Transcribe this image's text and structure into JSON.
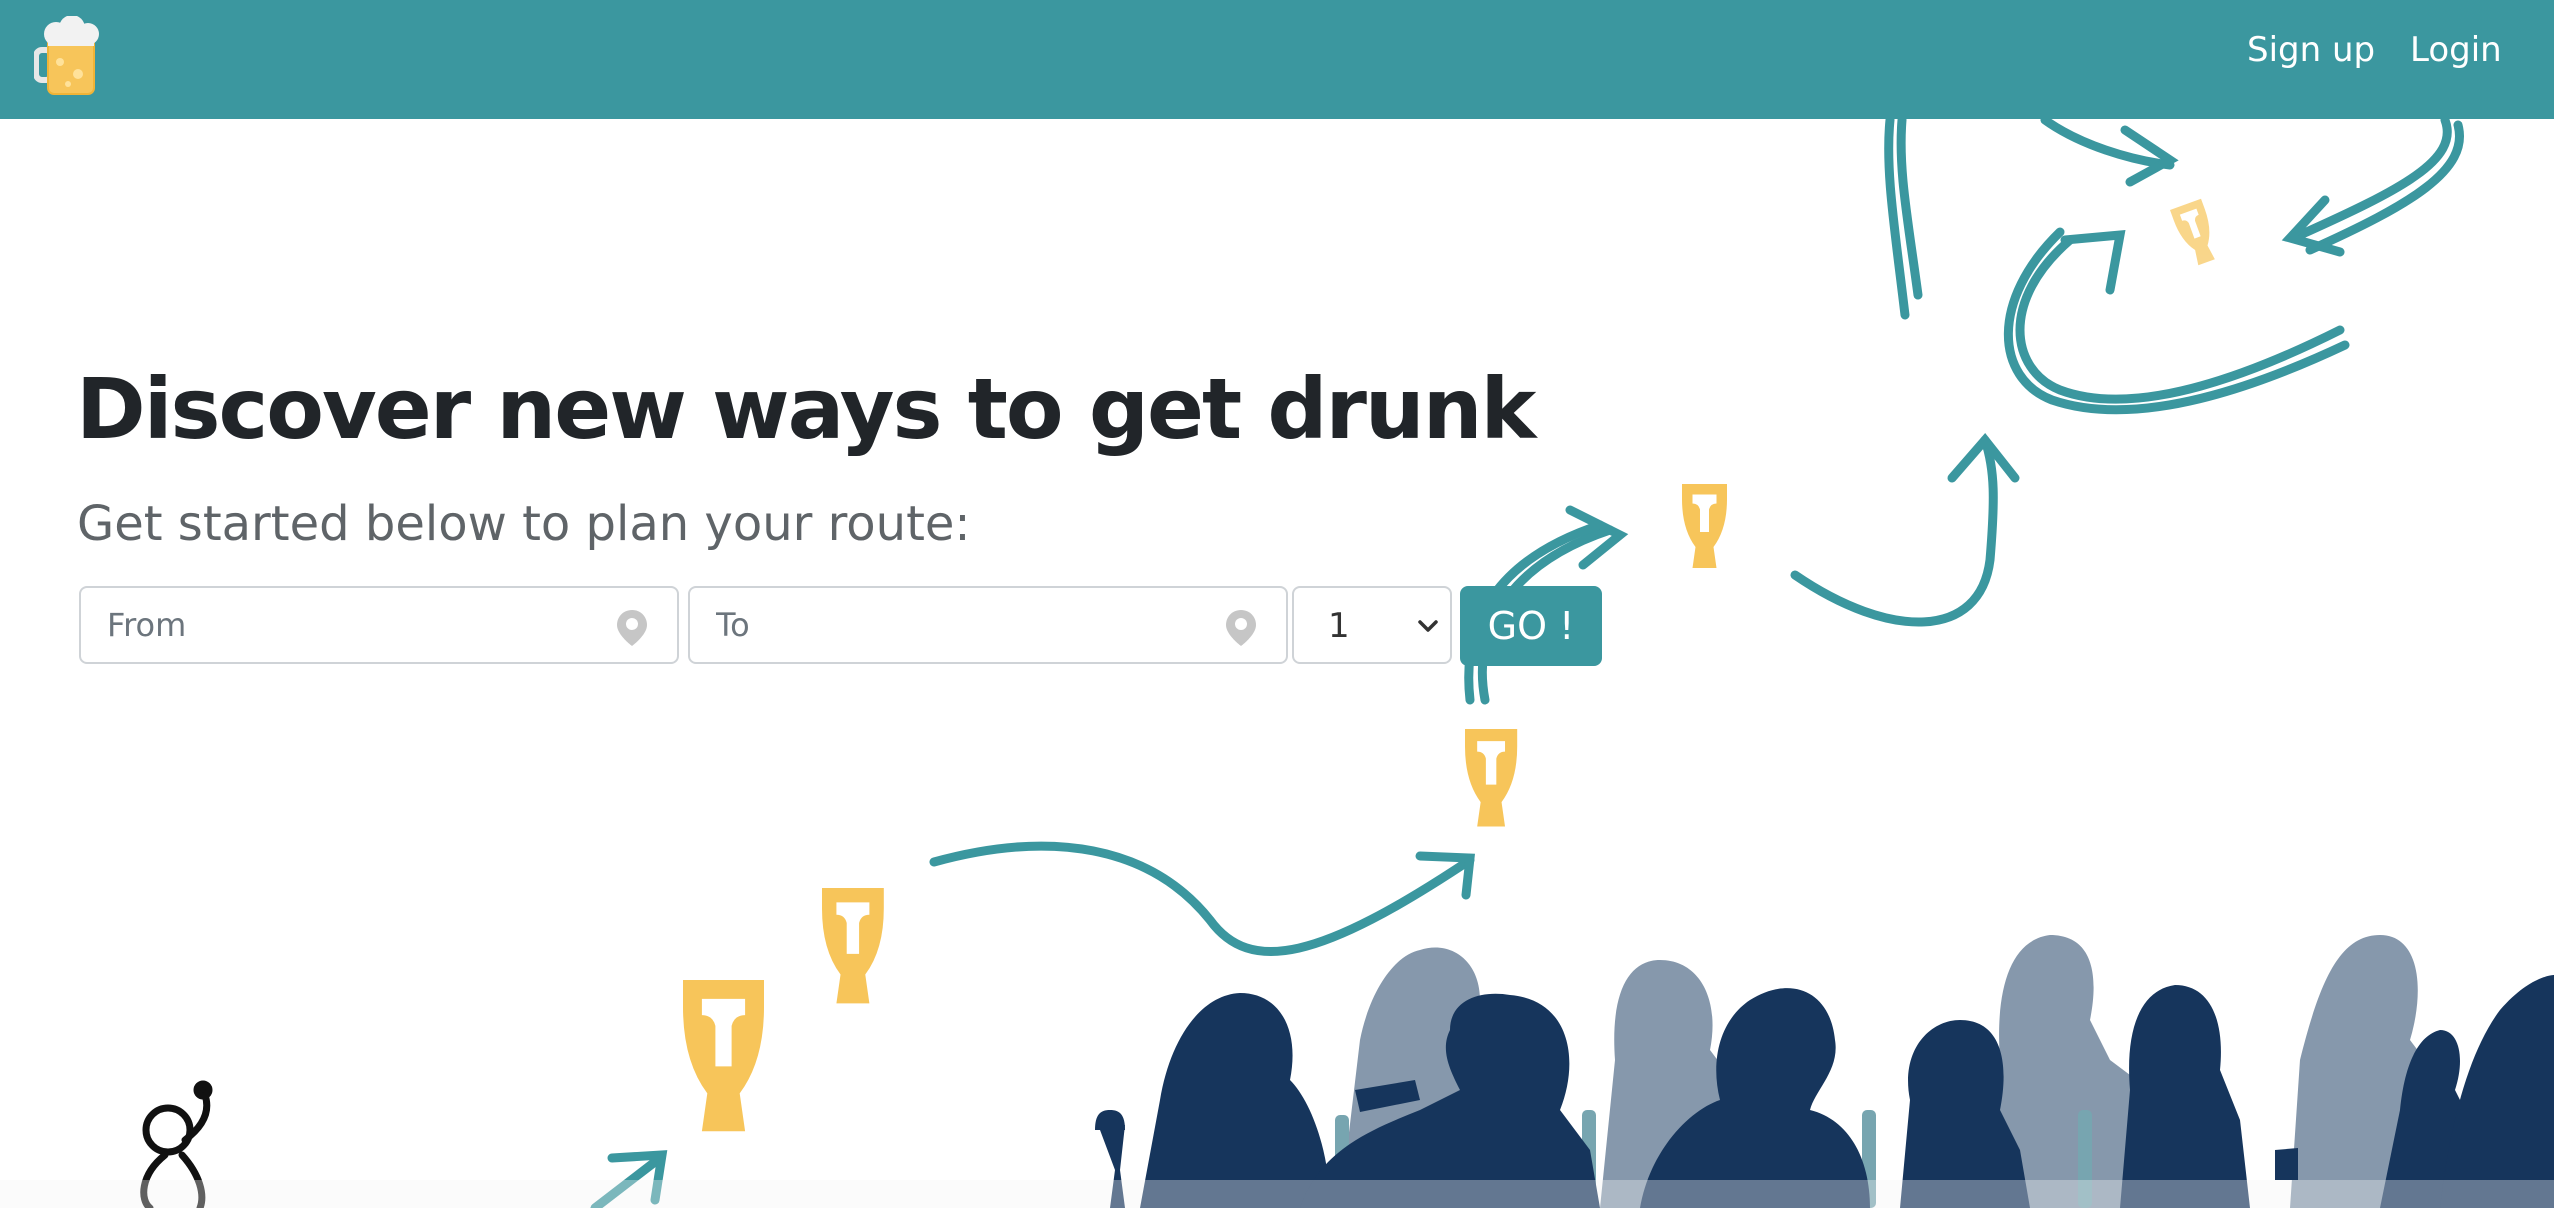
{
  "nav": {
    "logo_icon": "beer-mug-icon",
    "links": [
      "Sign up",
      "Login"
    ]
  },
  "hero": {
    "title": "Discover new ways to get drunk",
    "subtitle": "Get started below to plan your route:"
  },
  "form": {
    "from_placeholder": "From",
    "to_placeholder": "To",
    "count_value": "1",
    "go_label": "GO !",
    "pin_icon": "map-pin-icon",
    "select_icon": "chevron-down-icon"
  },
  "colors": {
    "primary": "#3b979f",
    "beer": "#f7c55a",
    "silhouette_dark": "#16355c",
    "silhouette_light": "#8698ac",
    "heading": "#212529"
  }
}
